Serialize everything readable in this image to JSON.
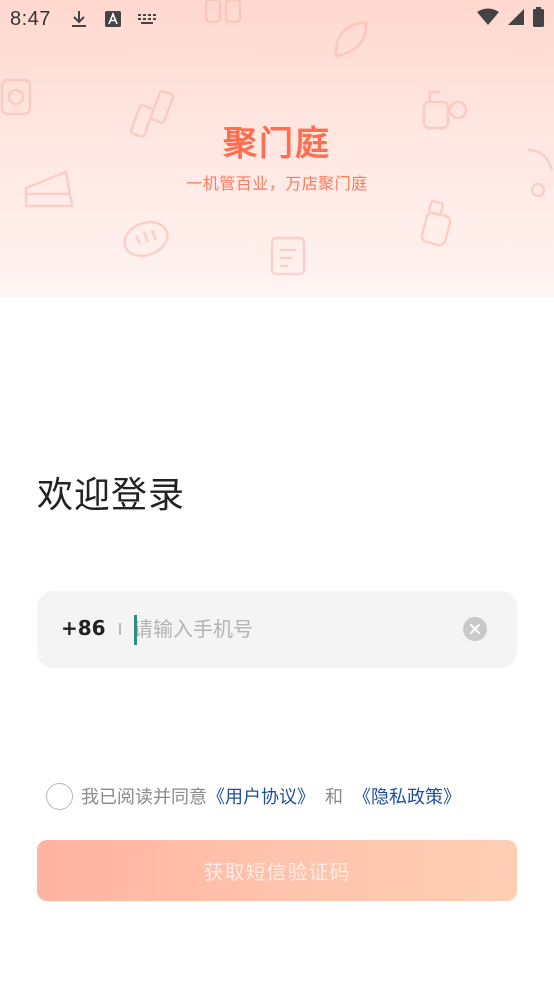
{
  "status_bar": {
    "time": "8:47",
    "icons_left": [
      "download-icon",
      "font-a-icon",
      "keyboard-icon"
    ],
    "icons_right": [
      "wifi-icon",
      "signal-icon",
      "battery-icon"
    ]
  },
  "hero": {
    "brand": "聚门庭",
    "slogan": "一机管百业，万店聚门庭",
    "decorative_icons": [
      "camera-icon",
      "pot-icon",
      "lipstick-icon",
      "cake-icon",
      "bread-icon",
      "clipboard-icon",
      "bottle-icon",
      "stroller-icon",
      "leaf-icon",
      "lotion-icon"
    ]
  },
  "login": {
    "welcome": "欢迎登录",
    "country_code": "+86",
    "phone_placeholder": "请输入手机号",
    "phone_value": "",
    "agree_prefix": "我已阅读并同意",
    "user_agreement": "《用户协议》",
    "and": "和",
    "privacy_policy": "《隐私政策》",
    "agree_checked": false,
    "sms_button": "获取短信验证码"
  },
  "colors": {
    "brand": "#ff6e4f",
    "link": "#1f4e9c",
    "button_gradient_start": "#ffb3a0",
    "button_gradient_end": "#ffcfb4"
  }
}
